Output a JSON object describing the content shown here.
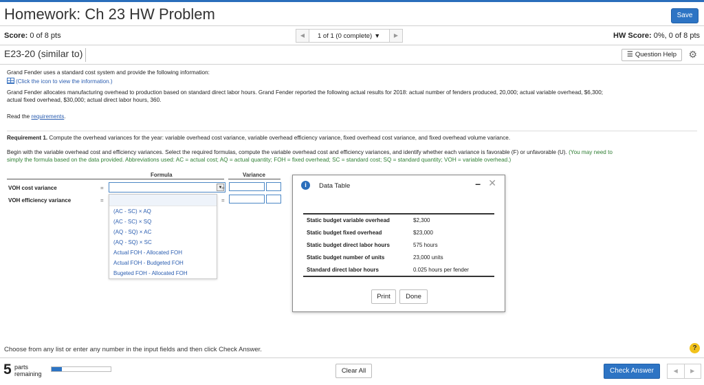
{
  "header": {
    "title": "Homework: Ch 23 HW Problem",
    "save_label": "Save"
  },
  "scorebar": {
    "score_label": "Score:",
    "score_value": "0 of 8 pts",
    "pager_prev": "◀",
    "pager_text": "1 of 1 (0 complete)",
    "pager_caret": "▼",
    "pager_next": "▶",
    "hw_label": "HW Score:",
    "hw_value": "0%, 0 of 8 pts"
  },
  "question": {
    "id": "E23-20 (similar to)",
    "help_label": "Question Help",
    "help_icon": "list-icon",
    "settings_icon": "gear-icon"
  },
  "content": {
    "intro": "Grand Fender uses a standard cost system and provide the following information:",
    "info_link": "(Click the icon to view the information.)",
    "para": "Grand Fender allocates manufacturing overhead to production based on standard direct labor hours. Grand Fender reported the following actual results for 2018: actual number of fenders produced, 20,000; actual variable overhead, $6,300;",
    "para2": "actual fixed overhead, $30,000; actual direct labor hours, 360.",
    "read_prefix": "Read the",
    "read_link": "requirements",
    "read_suffix": ".",
    "req_bold": "Requirement 1.",
    "req_text": " Compute the overhead variances for the year: variable overhead cost variance, variable overhead efficiency variance, fixed overhead cost variance, and fixed overhead volume variance.",
    "begin1": "Begin with the variable overhead cost and efficiency variances. Select the required formulas, compute the variable overhead cost and efficiency variances, and identify whether each variance is favorable (F) or unfavorable (U).",
    "begin1_green": " (You may need to",
    "begin2_green": "simply the formula based on the data provided. Abbreviations used: AC = actual cost; AQ = actual quantity; FOH = fixed overhead; SC = standard cost; SQ = standard quantity; VOH = variable overhead.)"
  },
  "formula_table": {
    "formula_header": "Formula",
    "variance_header": "Variance",
    "rows": [
      {
        "label": "VOH cost variance",
        "eq": "=",
        "eq2": "="
      },
      {
        "label": "VOH efficiency variance",
        "eq": "=",
        "eq2": "="
      }
    ],
    "dropdown_options": [
      "(AC - SC) × AQ",
      "(AC - SC) × SQ",
      "(AQ - SQ) × AC",
      "(AQ - SQ) × SC",
      "Actual FOH - Allocated FOH",
      "Actual FOH - Budgeted FOH",
      "Bugeted FOH - Allocated FOH"
    ]
  },
  "dialog": {
    "title": "Data Table",
    "minimize": "–",
    "close": "✕",
    "rows": [
      {
        "label": "Static budget variable overhead",
        "value": "$2,300"
      },
      {
        "label": "Static budget fixed overhead",
        "value": "$23,000"
      },
      {
        "label": "Static budget direct labor hours",
        "value": "575 hours"
      },
      {
        "label": "Static budget number of units",
        "value": "23,000 units"
      },
      {
        "label": "Standard direct labor hours",
        "value": "0.025 hours per fender"
      }
    ],
    "print_label": "Print",
    "done_label": "Done"
  },
  "footer": {
    "note": "Choose from any list or enter any number in the input fields and then click Check Answer.",
    "help": "?",
    "parts_number": "5",
    "parts_label1": "parts",
    "parts_label2": "remaining",
    "progress_fraction": 0.18,
    "clear_label": "Clear All",
    "check_label": "Check Answer",
    "nav_prev": "◀",
    "nav_next": "▶"
  },
  "colors": {
    "accent": "#2d74c4",
    "link": "#2a5db0",
    "hint_green": "#2e7d32",
    "help_yellow": "#f2c21b"
  }
}
